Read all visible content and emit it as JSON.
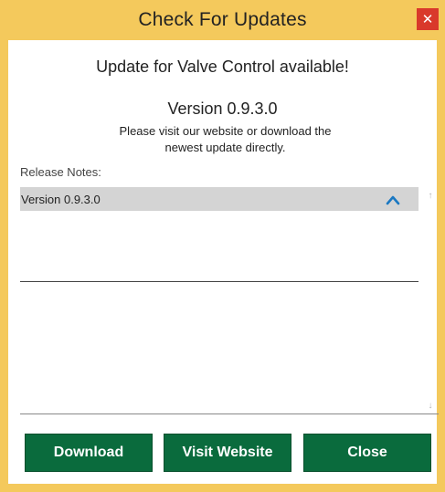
{
  "window": {
    "title": "Check For Updates",
    "close_glyph": "✕"
  },
  "headline": "Update for Valve Control available!",
  "version_text": "Version 0.9.3.0",
  "description": "Please visit our website or download the newest update directly.",
  "release_notes": {
    "label": "Release Notes:",
    "items": [
      {
        "label": "Version 0.9.3.0",
        "expanded": true,
        "toggle_icon": "chevron-up-icon"
      }
    ],
    "scroll_up_glyph": "↑",
    "scroll_down_glyph": "↓"
  },
  "buttons": {
    "download": "Download",
    "visit_website": "Visit Website",
    "close": "Close"
  },
  "colors": {
    "title_bar": "#f4c95c",
    "close_button": "#d9392b",
    "primary_button": "#0a6b3d",
    "selected_row": "#d4d4d4",
    "chevron": "#1a78c2"
  }
}
